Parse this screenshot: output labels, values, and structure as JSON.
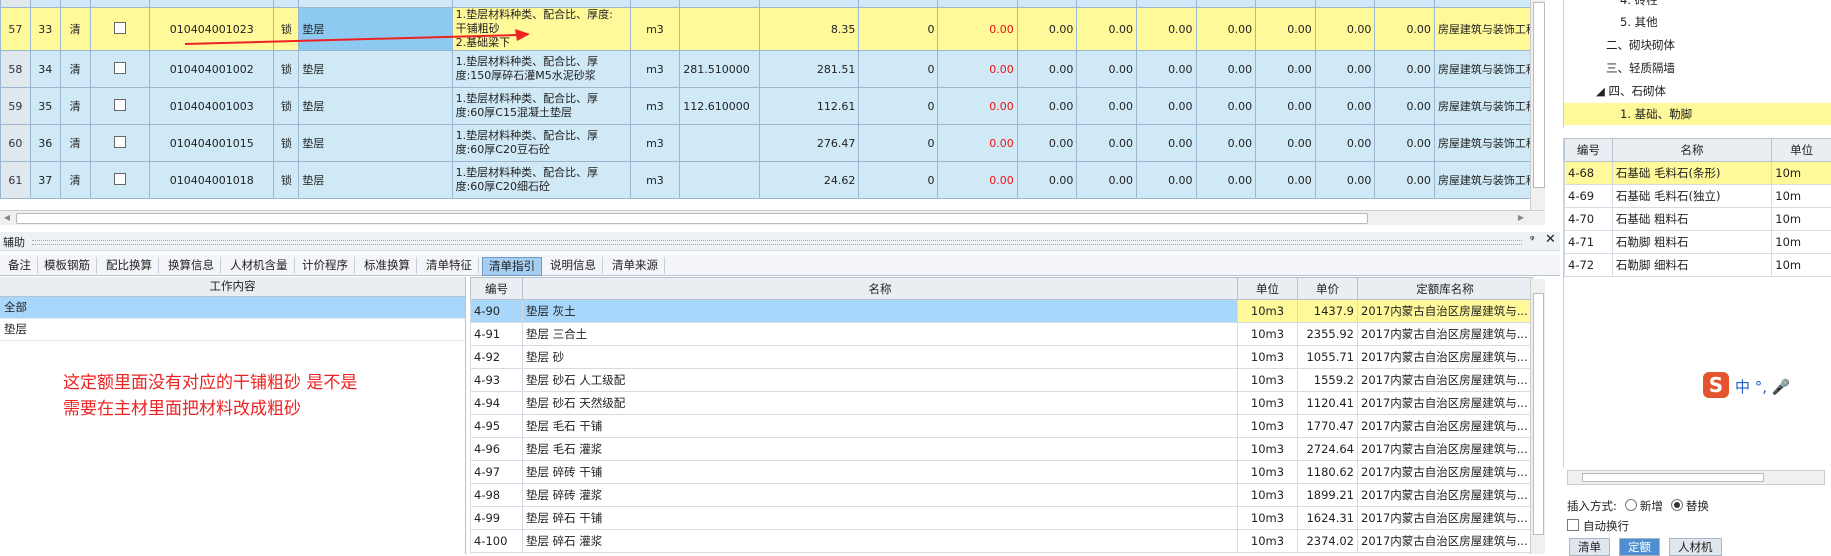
{
  "top_grid": {
    "partial_row": {
      "code": "",
      "name": "",
      "desc": "",
      "num_a": "",
      "num_b": ""
    },
    "rows": [
      {
        "rownum": "57",
        "seq": "33",
        "type": "清",
        "code": "010404001023",
        "lock": "锁",
        "name": "垫层",
        "desc1": "1.垫层材料种类、配合比、厚度:",
        "desc2": "干铺粗砂",
        "desc3": "2.基础梁下",
        "unit": "m3",
        "qty_expr": "",
        "qty": "8.35",
        "c1": "0",
        "c2": "0.00",
        "c3": "0.00",
        "c4": "0.00",
        "c5": "0.00",
        "c6": "0.00",
        "c7": "0.00",
        "c8": "0.00",
        "c9": "0.00",
        "lib": "房屋建筑与装饰工程"
      },
      {
        "rownum": "58",
        "seq": "34",
        "type": "清",
        "code": "010404001002",
        "lock": "锁",
        "name": "垫层",
        "desc1": "1.垫层材料种类、配合比、厚",
        "desc2": "度:150厚碎石灌M5水泥砂浆",
        "desc3": "",
        "unit": "m3",
        "qty_expr": "281.510000",
        "qty": "281.51",
        "c1": "0",
        "c2": "0.00",
        "c3": "0.00",
        "c4": "0.00",
        "c5": "0.00",
        "c6": "0.00",
        "c7": "0.00",
        "c8": "0.00",
        "c9": "0.00",
        "lib": "房屋建筑与装饰工程"
      },
      {
        "rownum": "59",
        "seq": "35",
        "type": "清",
        "code": "010404001003",
        "lock": "锁",
        "name": "垫层",
        "desc1": "1.垫层材料种类、配合比、厚",
        "desc2": "度:60厚C15混凝土垫层",
        "desc3": "",
        "unit": "m3",
        "qty_expr": "112.610000",
        "qty": "112.61",
        "c1": "0",
        "c2": "0.00",
        "c3": "0.00",
        "c4": "0.00",
        "c5": "0.00",
        "c6": "0.00",
        "c7": "0.00",
        "c8": "0.00",
        "c9": "0.00",
        "lib": "房屋建筑与装饰工程"
      },
      {
        "rownum": "60",
        "seq": "36",
        "type": "清",
        "code": "010404001015",
        "lock": "锁",
        "name": "垫层",
        "desc1": "1.垫层材料种类、配合比、厚",
        "desc2": "度:60厚C20豆石砼",
        "desc3": "",
        "unit": "m3",
        "qty_expr": "",
        "qty": "276.47",
        "c1": "0",
        "c2": "0.00",
        "c3": "0.00",
        "c4": "0.00",
        "c5": "0.00",
        "c6": "0.00",
        "c7": "0.00",
        "c8": "0.00",
        "c9": "0.00",
        "lib": "房屋建筑与装饰工程"
      },
      {
        "rownum": "61",
        "seq": "37",
        "type": "清",
        "code": "010404001018",
        "lock": "锁",
        "name": "垫层",
        "desc1": "1.垫层材料种类、配合比、厚",
        "desc2": "度:60厚C20细石砼",
        "desc3": "",
        "unit": "m3",
        "qty_expr": "",
        "qty": "24.62",
        "c1": "0",
        "c2": "0.00",
        "c3": "0.00",
        "c4": "0.00",
        "c5": "0.00",
        "c6": "0.00",
        "c7": "0.00",
        "c8": "0.00",
        "c9": "0.00",
        "lib": "房屋建筑与装饰工程"
      }
    ]
  },
  "aux": {
    "title": "辅助",
    "pin": "ᵠ",
    "close": "✕",
    "tabs": [
      "备注",
      "模板钢筋",
      "配比换算",
      "换算信息",
      "人材机含量",
      "计价程序",
      "标准换算",
      "清单特征",
      "清单指引",
      "说明信息",
      "清单来源"
    ],
    "active_tab": "清单指引"
  },
  "work": {
    "header": "工作内容",
    "items": [
      "全部",
      "垫层"
    ]
  },
  "annotation": {
    "line1": "这定额里面没有对应的干铺粗砂 是不是",
    "line2": "需要在主材里面把材料改成粗砂"
  },
  "quota": {
    "headers": {
      "code": "编号",
      "name": "名称",
      "unit": "单位",
      "price": "单价",
      "lib": "定额库名称"
    },
    "rows": [
      {
        "code": "4-90",
        "name": "垫层 灰土",
        "unit": "10m3",
        "price": "1437.9",
        "lib": "2017内蒙古自治区房屋建筑与..."
      },
      {
        "code": "4-91",
        "name": "垫层 三合土",
        "unit": "10m3",
        "price": "2355.92",
        "lib": "2017内蒙古自治区房屋建筑与..."
      },
      {
        "code": "4-92",
        "name": "垫层 砂",
        "unit": "10m3",
        "price": "1055.71",
        "lib": "2017内蒙古自治区房屋建筑与..."
      },
      {
        "code": "4-93",
        "name": "垫层 砂石 人工级配",
        "unit": "10m3",
        "price": "1559.2",
        "lib": "2017内蒙古自治区房屋建筑与..."
      },
      {
        "code": "4-94",
        "name": "垫层 砂石 天然级配",
        "unit": "10m3",
        "price": "1120.41",
        "lib": "2017内蒙古自治区房屋建筑与..."
      },
      {
        "code": "4-95",
        "name": "垫层 毛石 干铺",
        "unit": "10m3",
        "price": "1770.47",
        "lib": "2017内蒙古自治区房屋建筑与..."
      },
      {
        "code": "4-96",
        "name": "垫层 毛石 灌浆",
        "unit": "10m3",
        "price": "2724.64",
        "lib": "2017内蒙古自治区房屋建筑与..."
      },
      {
        "code": "4-97",
        "name": "垫层 碎砖 干铺",
        "unit": "10m3",
        "price": "1180.62",
        "lib": "2017内蒙古自治区房屋建筑与..."
      },
      {
        "code": "4-98",
        "name": "垫层 碎砖 灌浆",
        "unit": "10m3",
        "price": "1899.21",
        "lib": "2017内蒙古自治区房屋建筑与..."
      },
      {
        "code": "4-99",
        "name": "垫层 碎石 干铺",
        "unit": "10m3",
        "price": "1624.31",
        "lib": "2017内蒙古自治区房屋建筑与..."
      },
      {
        "code": "4-100",
        "name": "垫层 碎石 灌浆",
        "unit": "10m3",
        "price": "2374.02",
        "lib": "2017内蒙古自治区房屋建筑与..."
      }
    ]
  },
  "right_tree": {
    "items": [
      "4. 砖柱",
      "5. 其他",
      "二、砌块砌体",
      "三、轻质隔墙",
      "四、石砌体",
      "1. 基础、勒脚"
    ]
  },
  "right_table": {
    "headers": {
      "code": "编号",
      "name": "名称",
      "unit": "单位"
    },
    "rows": [
      {
        "code": "4-68",
        "name": "石基础 毛料石(条形)",
        "unit": "10m"
      },
      {
        "code": "4-69",
        "name": "石基础 毛料石(独立)",
        "unit": "10m"
      },
      {
        "code": "4-70",
        "name": "石基础 粗料石",
        "unit": "10m"
      },
      {
        "code": "4-71",
        "name": "石勒脚 粗料石",
        "unit": "10m"
      },
      {
        "code": "4-72",
        "name": "石勒脚 细料石",
        "unit": "10m"
      }
    ]
  },
  "ime": {
    "logo": "S",
    "text": "中 °, 🎤"
  },
  "insert": {
    "label": "插入方式:",
    "opt_new": "新增",
    "opt_replace": "替换"
  },
  "auto_wrap": {
    "label": "自动换行"
  },
  "bottom_tabs": [
    "清单",
    "定额",
    "人材机"
  ]
}
